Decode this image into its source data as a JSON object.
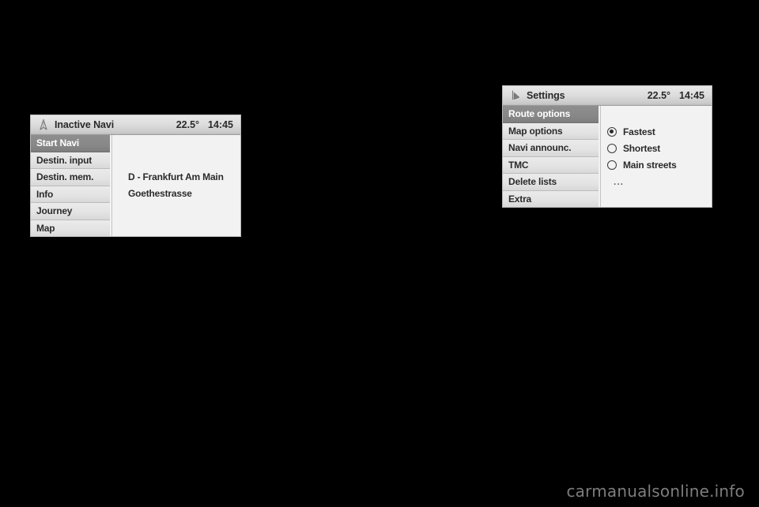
{
  "navi_panel": {
    "titlebar": {
      "icon": "navigation-arrow-icon",
      "title": "Inactive Navi",
      "temperature": "22.5°",
      "time": "14:45"
    },
    "menu": [
      {
        "label": "Start Navi",
        "selected": true
      },
      {
        "label": "Destin. input",
        "selected": false
      },
      {
        "label": "Destin. mem.",
        "selected": false
      },
      {
        "label": "Info",
        "selected": false
      },
      {
        "label": "Journey",
        "selected": false
      },
      {
        "label": "Map",
        "selected": false
      }
    ],
    "content": {
      "destination_city": "D - Frankfurt Am Main",
      "destination_street": "Goethestrasse"
    }
  },
  "settings_panel": {
    "titlebar": {
      "icon": "navigation-settings-icon",
      "title": "Settings",
      "temperature": "22.5°",
      "time": "14:45"
    },
    "menu": [
      {
        "label": "Route options",
        "selected": true
      },
      {
        "label": "Map options",
        "selected": false
      },
      {
        "label": "Navi announc.",
        "selected": false
      },
      {
        "label": "TMC",
        "selected": false
      },
      {
        "label": "Delete lists",
        "selected": false
      },
      {
        "label": "Extra",
        "selected": false
      }
    ],
    "route_options": [
      {
        "label": "Fastest",
        "selected": true
      },
      {
        "label": "Shortest",
        "selected": false
      },
      {
        "label": "Main streets",
        "selected": false
      }
    ],
    "more_indicator": "..."
  },
  "watermark": {
    "text": "carmanualsonline.info"
  },
  "colors": {
    "background": "#000000",
    "panel_bg": "#f0f0f0",
    "menu_item_bg": "#e3e3e3",
    "selected_bg": "#888888",
    "selected_text": "#ffffff",
    "text": "#2b2b2b",
    "watermark": "#7d7d7d"
  }
}
